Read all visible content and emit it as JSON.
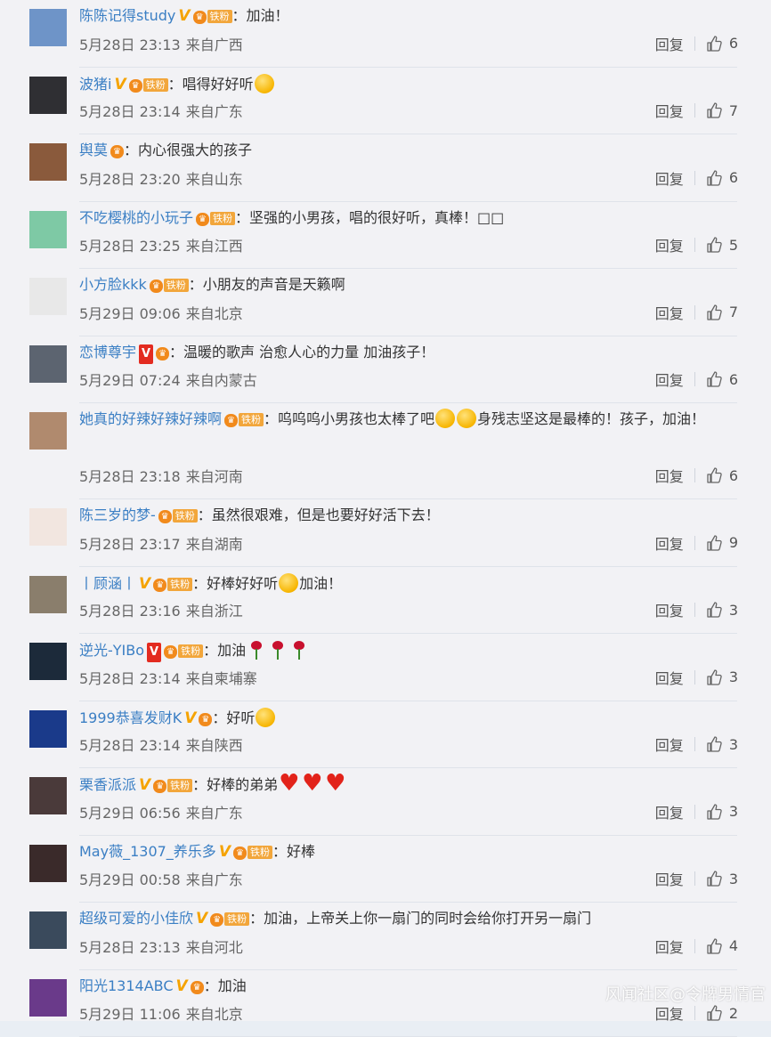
{
  "watermark": "风闻社区@令牌男情官",
  "labels": {
    "reply": "回复",
    "fan_badge": "铁粉"
  },
  "comments": [
    {
      "user": "陈陈记得study",
      "v": "gold",
      "fan": true,
      "text": "：加油！",
      "date": "5月28日 23:13",
      "loc": "来自广西",
      "likes": "6",
      "avatar": "#6e94c8"
    },
    {
      "user": "波猪i",
      "v": "gold",
      "fan": true,
      "text": "：唱得好好听",
      "emoji": "face",
      "date": "5月28日 23:14",
      "loc": "来自广东",
      "likes": "7",
      "avatar": "#2f2f33"
    },
    {
      "user": "舆莫",
      "v": "",
      "fan": false,
      "text": "：内心很强大的孩子",
      "date": "5月28日 23:20",
      "loc": "来自山东",
      "likes": "6",
      "avatar": "#8a5a3c"
    },
    {
      "user": "不吃樱桃的小玩子",
      "v": "",
      "fan": true,
      "text": "：坚强的小男孩，唱的很好听，真棒！□□",
      "date": "5月28日 23:25",
      "loc": "来自江西",
      "likes": "5",
      "avatar": "#7ec9a5"
    },
    {
      "user": "小方脸kkk",
      "v": "",
      "fan": true,
      "text": "：小朋友的声音是天籁啊",
      "date": "5月29日 09:06",
      "loc": "来自北京",
      "likes": "7",
      "avatar": "#e8e8e8"
    },
    {
      "user": "恋博尊宇",
      "v": "red",
      "fan": false,
      "text": "：温暖的歌声 治愈人心的力量 加油孩子！",
      "date": "5月29日 07:24",
      "loc": "来自内蒙古",
      "likes": "6",
      "avatar": "#5c6470"
    },
    {
      "user": "她真的好辣好辣好辣啊",
      "v": "",
      "fan": true,
      "text": "：呜呜呜小男孩也太棒了吧",
      "text2": "身残志坚这是最棒的！孩子，加油！",
      "emoji": "cry",
      "tall": true,
      "date": "5月28日 23:18",
      "loc": "来自河南",
      "likes": "6",
      "avatar": "#b08a6e"
    },
    {
      "user": "陈三岁的梦-",
      "v": "",
      "fan": true,
      "text": "：虽然很艰难，但是也要好好活下去！",
      "date": "5月28日 23:17",
      "loc": "来自湖南",
      "likes": "9",
      "avatar": "#f2e6e0"
    },
    {
      "user": "丨顾涵丨",
      "v": "gold",
      "fan": true,
      "text": "：好棒好好听",
      "emoji": "love",
      "text3": "加油！",
      "date": "5月28日 23:16",
      "loc": "来自浙江",
      "likes": "3",
      "avatar": "#8a7e6c"
    },
    {
      "user": "逆光-YIBo",
      "v": "red",
      "fan": true,
      "text": "：加油",
      "emoji": "rose3",
      "date": "5月28日 23:14",
      "loc": "来自柬埔寨",
      "likes": "3",
      "avatar": "#1c2a3a"
    },
    {
      "user": "1999恭喜发财K",
      "v": "gold",
      "fan": false,
      "text": "：好听",
      "emoji": "face",
      "date": "5月28日 23:14",
      "loc": "来自陕西",
      "likes": "3",
      "avatar": "#1a3a8a"
    },
    {
      "user": "栗香派派",
      "v": "gold",
      "fan": true,
      "text": "：好棒的弟弟",
      "emoji": "heart3",
      "date": "5月29日 06:56",
      "loc": "来自广东",
      "likes": "3",
      "avatar": "#4a3a3a"
    },
    {
      "user": "May薇_1307_养乐多",
      "v": "gold",
      "fan": true,
      "text": "：好棒",
      "date": "5月29日 00:58",
      "loc": "来自广东",
      "likes": "3",
      "avatar": "#3a2a2a"
    },
    {
      "user": "超级可爱的小佳欣",
      "v": "gold",
      "fan": true,
      "text": "：加油，上帝关上你一扇门的同时会给你打开另一扇门",
      "date": "5月28日 23:13",
      "loc": "来自河北",
      "likes": "4",
      "avatar": "#3a4a5c"
    },
    {
      "user": "阳光1314ABC",
      "v": "gold",
      "fan": false,
      "text": "：加油",
      "date": "5月29日 11:06",
      "loc": "来自北京",
      "likes": "2",
      "avatar": "#6a3a8a"
    }
  ]
}
